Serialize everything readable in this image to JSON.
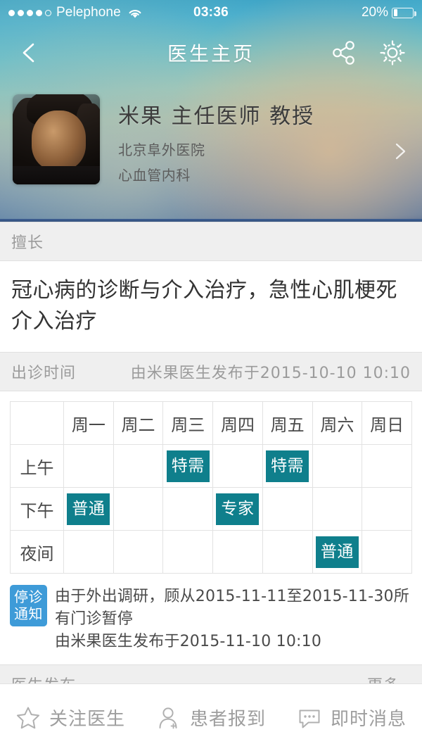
{
  "statusbar": {
    "carrier": "Pelephone",
    "time": "03:36",
    "battery_label": "20%",
    "battery_percent": 20,
    "signal_dots_filled": 4,
    "signal_dots_total": 5,
    "wifi_icon": "wifi-icon",
    "battery_icon": "battery-icon"
  },
  "navbar": {
    "title": "医生主页",
    "back_icon": "chevron-left-icon",
    "share_icon": "share-icon",
    "settings_icon": "gear-icon"
  },
  "doctor": {
    "name_line": "米果 主任医师 教授",
    "hospital": "北京阜外医院",
    "department": "心血管内科",
    "avatar_icon": "doctor-avatar",
    "chevron_icon": "chevron-right-icon"
  },
  "specialty_section": {
    "label": "擅长",
    "text": "冠心病的诊断与介入治疗，急性心肌梗死介入治疗"
  },
  "schedule_section": {
    "label": "出诊时间",
    "published": "由米果医生发布于2015-10-10 10:10",
    "columns": [
      "",
      "周一",
      "周二",
      "周三",
      "周四",
      "周五",
      "周六",
      "周日"
    ],
    "rows": [
      {
        "label": "上午",
        "cells": [
          "",
          "",
          "特需",
          "",
          "特需",
          "",
          ""
        ]
      },
      {
        "label": "下午",
        "cells": [
          "普通",
          "",
          "",
          "专家",
          "",
          "",
          ""
        ]
      },
      {
        "label": "夜间",
        "cells": [
          "",
          "",
          "",
          "",
          "",
          "普通",
          ""
        ]
      }
    ],
    "chip_color": "#0f7f8c"
  },
  "notice": {
    "badge_line1": "停诊",
    "badge_line2": "通知",
    "badge_color": "#3e9bd8",
    "line1": "由于外出调研，顾从2015-11-11至2015-11-30所有门诊暂停",
    "line2": "由米果医生发布于2015-11-10 10:10"
  },
  "posts_section": {
    "label": "医生发布",
    "more": "更多.."
  },
  "toolbar": {
    "items": [
      {
        "label": "关注医生",
        "icon": "star-icon"
      },
      {
        "label": "患者报到",
        "icon": "user-add-icon"
      },
      {
        "label": "即时消息",
        "icon": "chat-bubble-icon"
      }
    ]
  }
}
